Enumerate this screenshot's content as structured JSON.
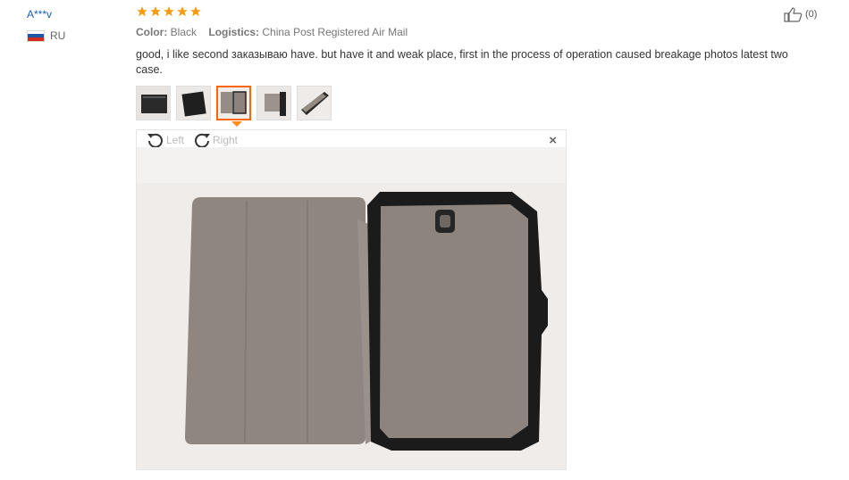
{
  "user": {
    "name": "A***v",
    "country": "RU"
  },
  "review": {
    "rating": 5,
    "color_label": "Color:",
    "color_value": "Black",
    "logistics_label": "Logistics:",
    "logistics_value": "China Post Registered Air Mail",
    "helpful_count": "(0)",
    "text": "good, i like second заказываю have. but have it and weak place, first in the process of operation caused breakage photos latest two case."
  },
  "viewer": {
    "left_label": "Left",
    "right_label": "Right",
    "close": "×",
    "selected_thumbnail_index": 3,
    "thumbnail_count": 5
  },
  "icons": [
    "star-icon",
    "thumbs-up-icon",
    "rotate-left-icon",
    "rotate-right-icon",
    "close-icon"
  ],
  "colors": {
    "accent": "#ff6600",
    "star": "#f39c12",
    "link": "#1a5fb4"
  }
}
